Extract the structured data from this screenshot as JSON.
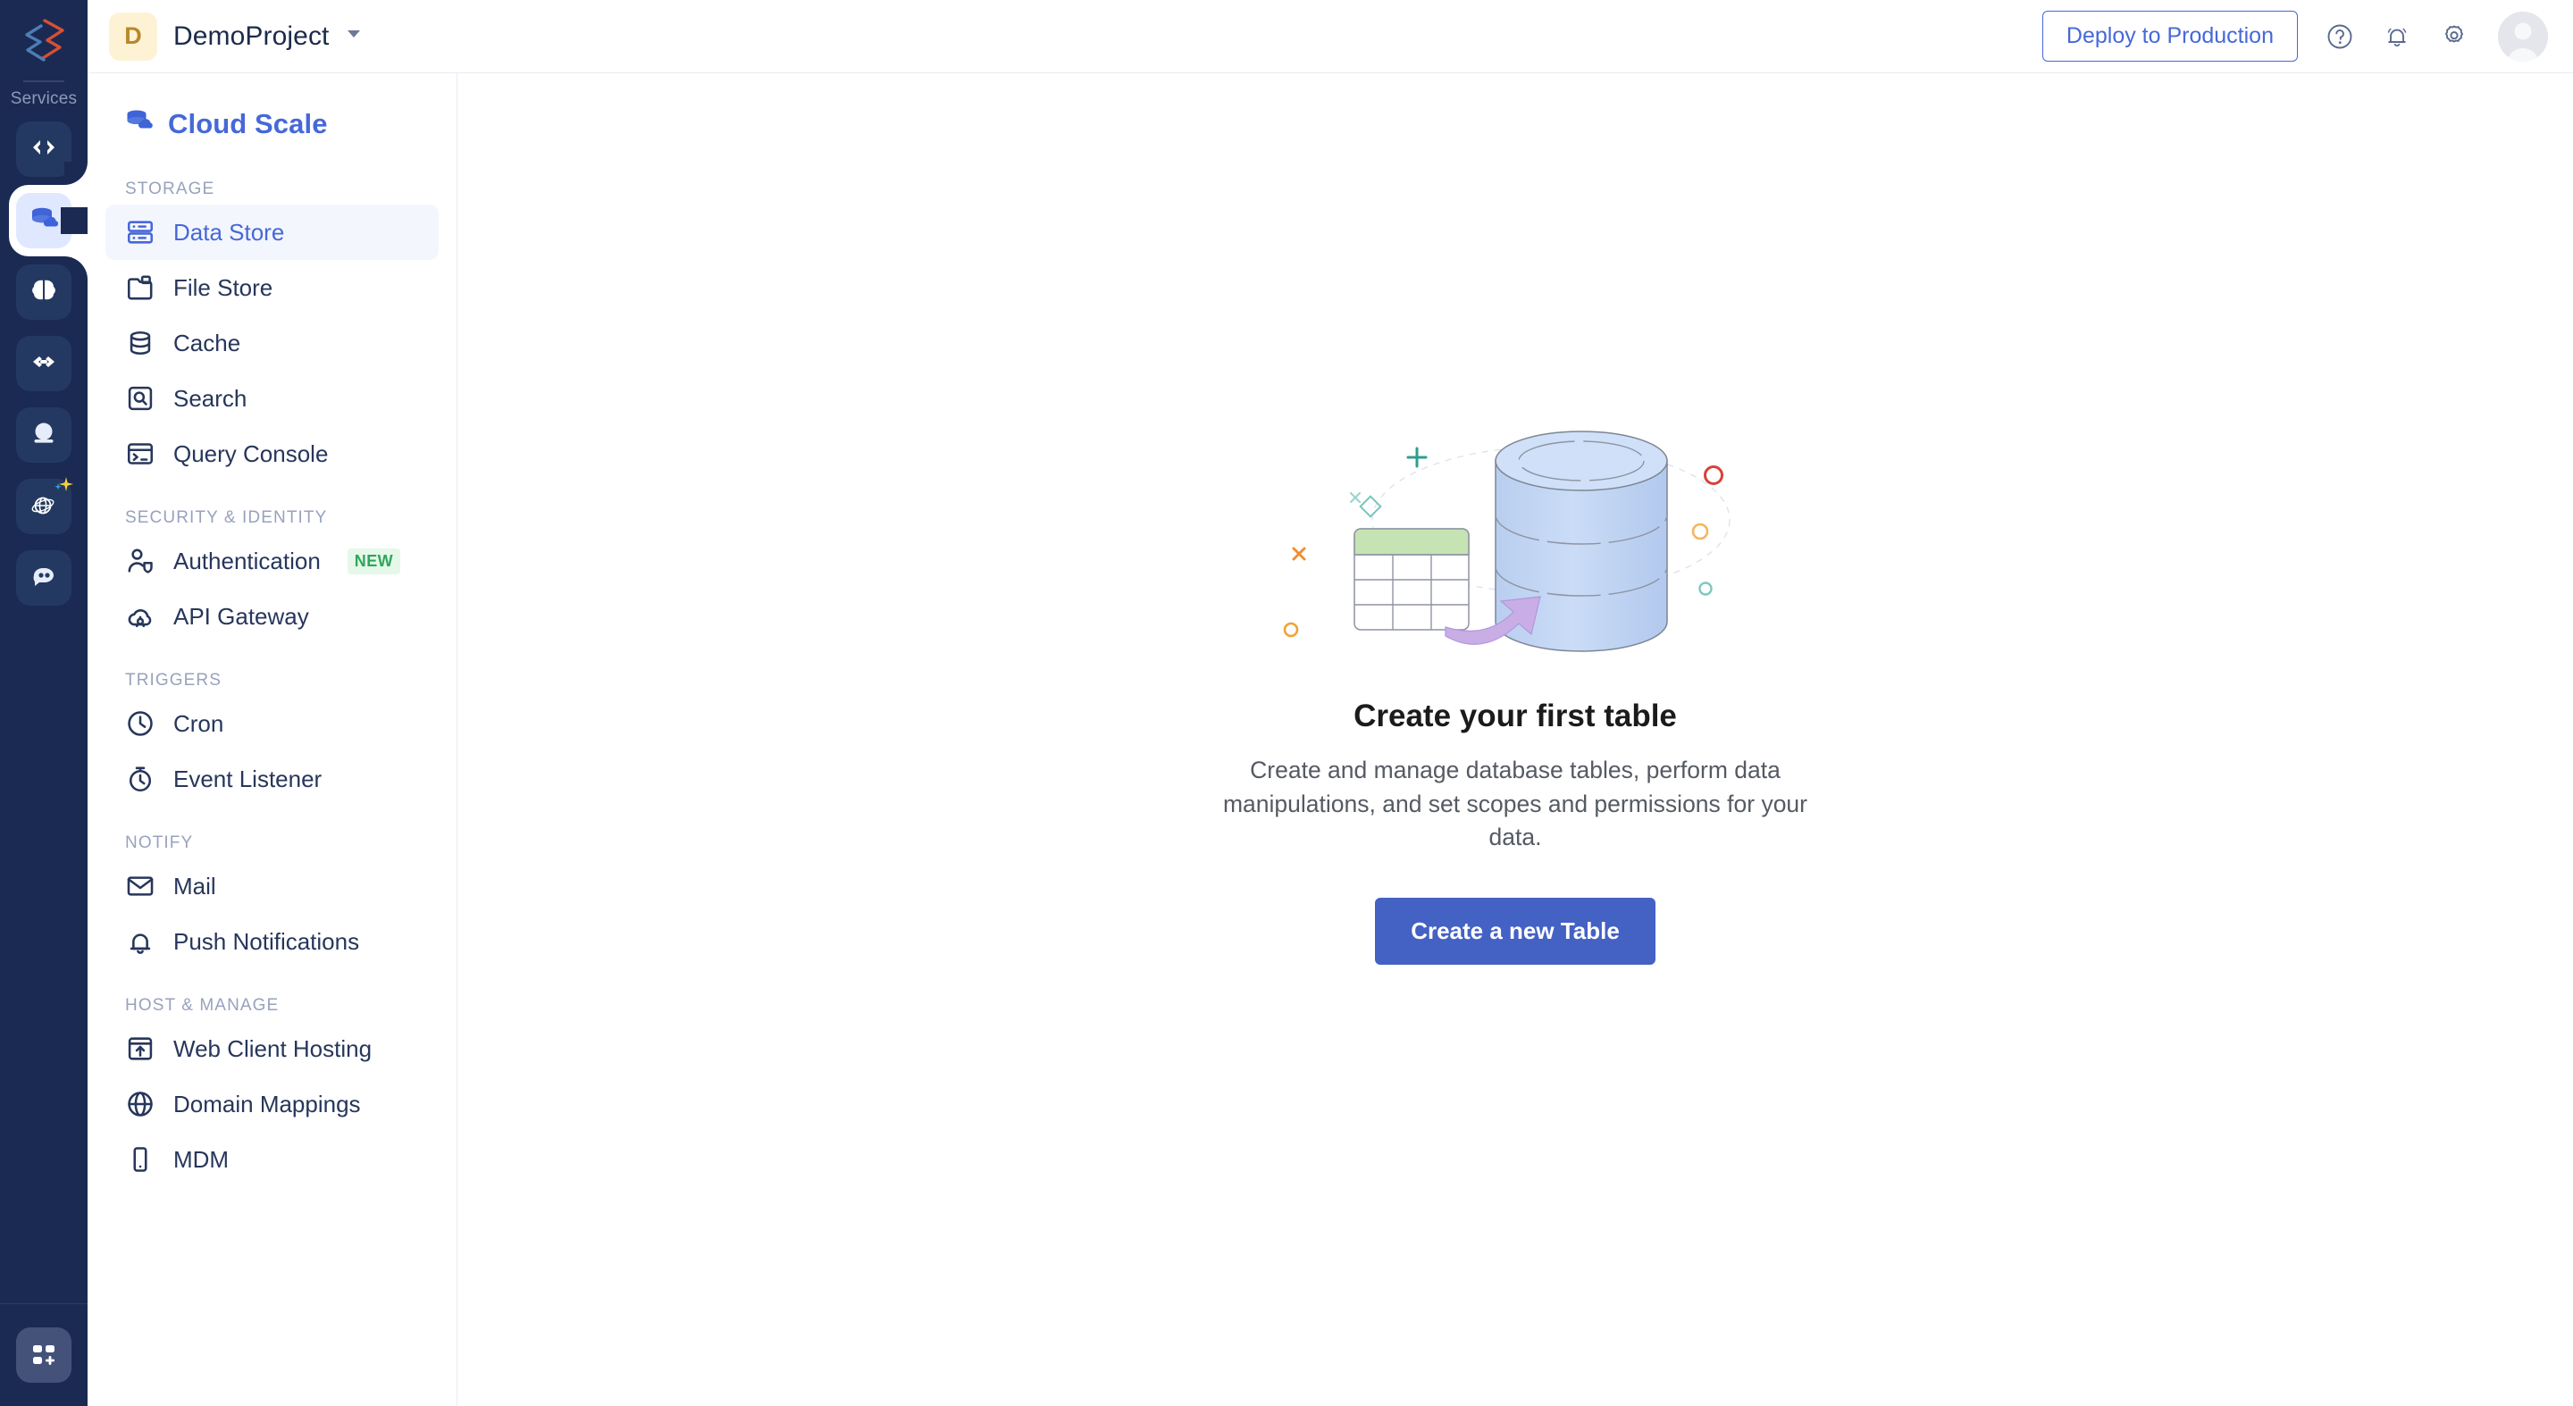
{
  "rail": {
    "logo_icon": "catalyst-logo-icon",
    "services_label": "Services",
    "items": [
      {
        "name": "code-brackets-icon",
        "active": false
      },
      {
        "name": "cloud-scale-database-icon",
        "active": true
      },
      {
        "name": "brain-icon",
        "active": false
      },
      {
        "name": "infinity-link-icon",
        "active": false
      },
      {
        "name": "crystal-ball-icon",
        "active": false
      },
      {
        "name": "globe-sparkle-icon",
        "active": false
      },
      {
        "name": "chat-bubble-icon",
        "active": false
      }
    ],
    "bottom_icon": "app-grid-plus-icon"
  },
  "topbar": {
    "project_initial": "D",
    "project_name": "DemoProject",
    "caret_icon": "chevron-down-icon",
    "deploy_label": "Deploy to Production",
    "help_icon": "help-circle-icon",
    "notifications_icon": "bell-icon",
    "settings_icon": "gear-icon",
    "avatar_icon": "user-avatar"
  },
  "sidenav": {
    "service_title": "Cloud Scale",
    "service_icon": "cloud-scale-icon",
    "groups": [
      {
        "label": "STORAGE",
        "items": [
          {
            "label": "Data Store",
            "icon": "data-store-icon",
            "active": true,
            "badge": ""
          },
          {
            "label": "File Store",
            "icon": "file-store-icon",
            "active": false,
            "badge": ""
          },
          {
            "label": "Cache",
            "icon": "cache-database-icon",
            "active": false,
            "badge": ""
          },
          {
            "label": "Search",
            "icon": "search-icon",
            "active": false,
            "badge": ""
          },
          {
            "label": "Query Console",
            "icon": "terminal-icon",
            "active": false,
            "badge": ""
          }
        ]
      },
      {
        "label": "SECURITY & IDENTITY",
        "items": [
          {
            "label": "Authentication",
            "icon": "user-shield-icon",
            "active": false,
            "badge": "NEW"
          },
          {
            "label": "API Gateway",
            "icon": "api-gateway-cloud-icon",
            "active": false,
            "badge": ""
          }
        ]
      },
      {
        "label": "TRIGGERS",
        "items": [
          {
            "label": "Cron",
            "icon": "clock-icon",
            "active": false,
            "badge": ""
          },
          {
            "label": "Event Listener",
            "icon": "stopwatch-icon",
            "active": false,
            "badge": ""
          }
        ]
      },
      {
        "label": "NOTIFY",
        "items": [
          {
            "label": "Mail",
            "icon": "envelope-icon",
            "active": false,
            "badge": ""
          },
          {
            "label": "Push Notifications",
            "icon": "bell-icon",
            "active": false,
            "badge": ""
          }
        ]
      },
      {
        "label": "HOST & MANAGE",
        "items": [
          {
            "label": "Web Client Hosting",
            "icon": "web-upload-icon",
            "active": false,
            "badge": ""
          },
          {
            "label": "Domain Mappings",
            "icon": "globe-icon",
            "active": false,
            "badge": ""
          },
          {
            "label": "MDM",
            "icon": "mobile-device-icon",
            "active": false,
            "badge": ""
          }
        ]
      }
    ]
  },
  "content": {
    "illustration": "database-table-import-illustration",
    "title": "Create your first table",
    "description_line1": "Create and manage database tables, perform data",
    "description_line2": "manipulations, and set scopes and permissions for your data.",
    "cta_label": "Create a new Table"
  },
  "colors": {
    "rail_bg": "#1b2a52",
    "accent": "#4668d8",
    "cta_bg": "#4461c4",
    "badge_new_text": "#2fa65a",
    "badge_new_bg": "#e5f8ea",
    "project_badge_bg": "#fdf3d4",
    "project_badge_text": "#b8882a",
    "active_nav_bg": "#f4f6fd",
    "text_primary": "#27365b",
    "text_muted": "#98a2bd"
  }
}
